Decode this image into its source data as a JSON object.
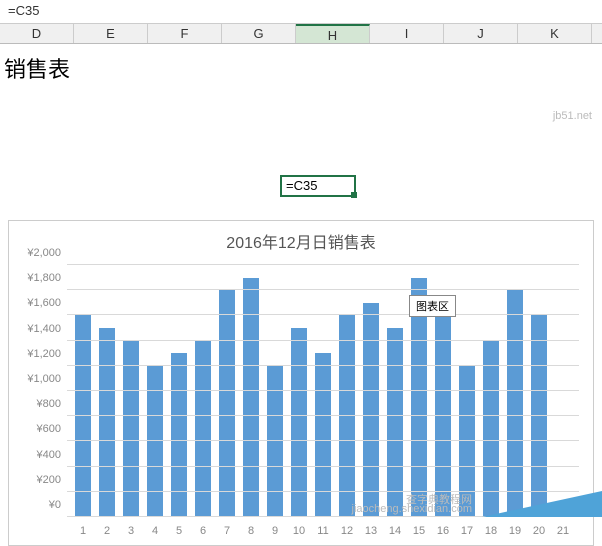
{
  "formula_bar": {
    "value": "=C35"
  },
  "columns": [
    "D",
    "E",
    "F",
    "G",
    "H",
    "I",
    "J",
    "K"
  ],
  "active_column": "H",
  "sheet": {
    "title": "销售表",
    "active_cell_display": "=C35"
  },
  "tooltip": {
    "label": "图表区"
  },
  "chart_data": {
    "type": "bar",
    "title": "2016年12月日销售表",
    "xlabel": "",
    "ylabel": "",
    "ylim": [
      0,
      2000
    ],
    "y_ticks": [
      "¥0",
      "¥200",
      "¥400",
      "¥600",
      "¥800",
      "¥1,000",
      "¥1,200",
      "¥1,400",
      "¥1,600",
      "¥1,800",
      "¥2,000"
    ],
    "categories": [
      "1",
      "2",
      "3",
      "4",
      "5",
      "6",
      "7",
      "8",
      "9",
      "10",
      "11",
      "12",
      "13",
      "14",
      "15",
      "16",
      "17",
      "18",
      "19",
      "20",
      "21"
    ],
    "values": [
      1600,
      1500,
      1400,
      1200,
      1300,
      1400,
      1800,
      1900,
      1200,
      1500,
      1300,
      1600,
      1700,
      1500,
      1900,
      1600,
      1200,
      1400,
      1800,
      1600,
      50
    ]
  },
  "watermarks": {
    "wm1": "jb51.net",
    "wm2": "查字典教程网",
    "wm3": "jiaocheng.shexidian.com"
  }
}
